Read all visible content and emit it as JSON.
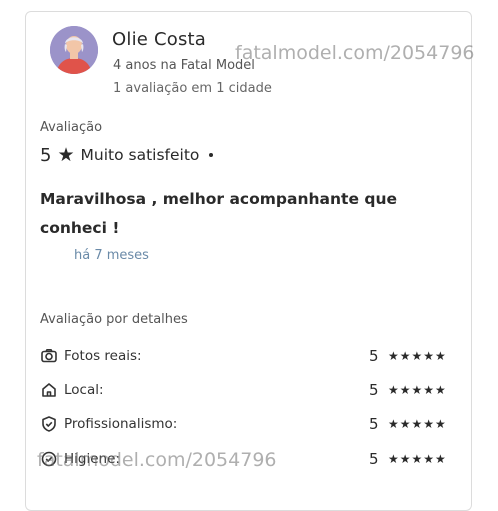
{
  "reviewer": {
    "name": "Olie Costa",
    "tenure": "4 anos na Fatal Model",
    "summary": "1 avaliação em 1 cidade"
  },
  "rating": {
    "label": "Avaliação",
    "score": "5",
    "star_icon": "★",
    "text": "Muito satisfeito"
  },
  "review": {
    "text": "Maravilhosa , melhor acompanhante que conheci !",
    "time_ago": "há 7 meses"
  },
  "details": {
    "title": "Avaliação por detalhes",
    "items": [
      {
        "icon": "camera-icon",
        "label": "Fotos reais:",
        "score": "5",
        "stars": "★★★★★"
      },
      {
        "icon": "home-icon",
        "label": "Local:",
        "score": "5",
        "stars": "★★★★★"
      },
      {
        "icon": "shield-check-icon",
        "label": "Profissionalismo:",
        "score": "5",
        "stars": "★★★★★"
      },
      {
        "icon": "check-circle-icon",
        "label": "Higiene:",
        "score": "5",
        "stars": "★★★★★"
      }
    ]
  },
  "watermarks": {
    "top": "fatalmodel.com/2054796",
    "bottom": "fatalmodel.com/2054796"
  },
  "colors": {
    "avatar_bg": "#9b93c9",
    "avatar_shirt": "#e0534a",
    "time_ago": "#6a8aa8"
  }
}
